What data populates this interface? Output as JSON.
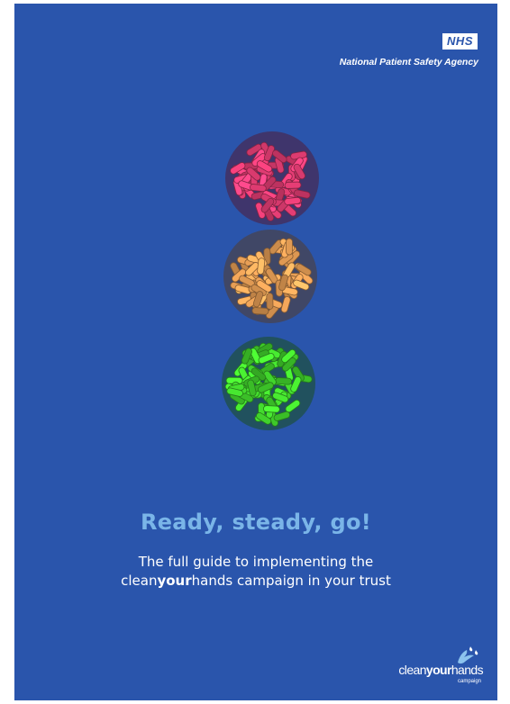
{
  "header": {
    "nhs_logo": "NHS",
    "agency": "National Patient Safety Agency"
  },
  "illustration": {
    "description_icons": [
      "red-bacteria-cluster-icon",
      "amber-bacteria-cluster-icon",
      "green-bacteria-cluster-icon"
    ],
    "colors": {
      "red": "#f0407a",
      "amber": "#f2a65a",
      "green": "#44dd2e",
      "background": "#2a55ac"
    }
  },
  "headline": "Ready, steady, go!",
  "subtitle": {
    "line1": "The full guide to implementing the",
    "line2_prefix": "clean",
    "line2_bold": "your",
    "line2_suffix": "hands campaign in your trust"
  },
  "campaign_logo": {
    "clean": "clean",
    "your": "your",
    "hands": "hands",
    "sub": "campaign"
  }
}
